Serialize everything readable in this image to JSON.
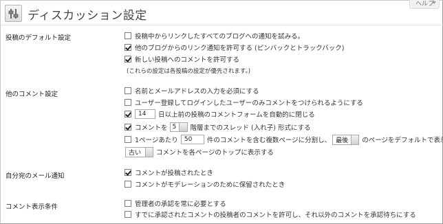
{
  "header": {
    "title": "ディスカッション設定",
    "help_label": "ヘルプ"
  },
  "sections": {
    "default_post": {
      "label": "投稿のデフォルト設定",
      "items": [
        {
          "label": "投稿中からリンクしたすべてのブログへの通知を試みる。",
          "checked": false
        },
        {
          "label": "他のブログからのリンク通知を許可する (ピンバックとトラックバック)",
          "checked": true
        },
        {
          "label": "新しい投稿へのコメントを許可する",
          "checked": true
        }
      ],
      "note": "(これらの設定は各投稿の設定が優先されます。)"
    },
    "other_comment": {
      "label": "他のコメント設定",
      "require_name_email": "名前とメールアドレスの入力を必須にする",
      "registered_only": "ユーザー登録してログインしたユーザーのみコメントをつけられるようにする",
      "close_days_value": "14",
      "close_days_text": "日以上前の投稿のコメントフォームを自動的に閉じる",
      "thread_prefix": "コメントを",
      "thread_depth": "5",
      "thread_suffix": "階層までのスレッド (入れ子) 形式にする",
      "paginate_prefix": "1ページあたり",
      "paginate_count": "50",
      "paginate_middle": "件のコメントを含む複数ページに分割し、",
      "paginate_page": "最後",
      "paginate_suffix": "のページをデフォルトで表示する",
      "order_value": "古い",
      "order_suffix": "コメントを各ページのトップに表示する",
      "checked": {
        "require_name_email": false,
        "registered_only": false,
        "close_days": true,
        "thread": true,
        "paginate": false
      }
    },
    "email_me": {
      "label": "自分宛のメール通知",
      "items": [
        {
          "label": "コメントが投稿されたとき",
          "checked": true
        },
        {
          "label": "コメントがモデレーションのために保留されたとき",
          "checked": false
        }
      ]
    },
    "before_comment": {
      "label": "コメント表示条件",
      "items": [
        {
          "label": "管理者の承認を常に必要とする",
          "checked": false
        },
        {
          "label": "すでに承認されたコメントの投稿者のコメントを許可し、それ以外のコメントを承認待ちにする",
          "checked": false
        }
      ]
    }
  },
  "icons": {
    "header": "settings-sliders-icon"
  }
}
